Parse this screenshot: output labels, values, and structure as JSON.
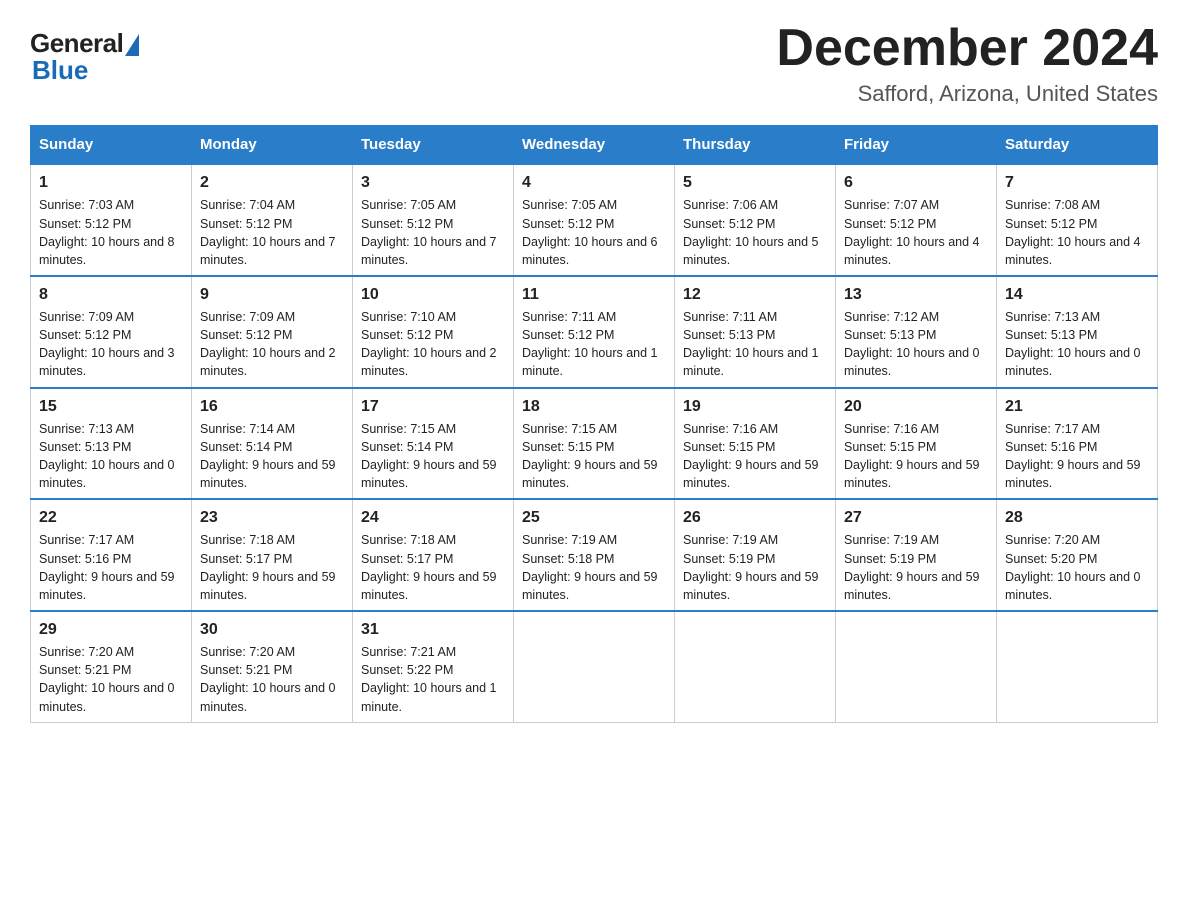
{
  "logo": {
    "general": "General",
    "blue": "Blue"
  },
  "title": "December 2024",
  "location": "Safford, Arizona, United States",
  "days": [
    "Sunday",
    "Monday",
    "Tuesday",
    "Wednesday",
    "Thursday",
    "Friday",
    "Saturday"
  ],
  "weeks": [
    [
      {
        "date": "1",
        "sunrise": "7:03 AM",
        "sunset": "5:12 PM",
        "daylight": "10 hours and 8 minutes."
      },
      {
        "date": "2",
        "sunrise": "7:04 AM",
        "sunset": "5:12 PM",
        "daylight": "10 hours and 7 minutes."
      },
      {
        "date": "3",
        "sunrise": "7:05 AM",
        "sunset": "5:12 PM",
        "daylight": "10 hours and 7 minutes."
      },
      {
        "date": "4",
        "sunrise": "7:05 AM",
        "sunset": "5:12 PM",
        "daylight": "10 hours and 6 minutes."
      },
      {
        "date": "5",
        "sunrise": "7:06 AM",
        "sunset": "5:12 PM",
        "daylight": "10 hours and 5 minutes."
      },
      {
        "date": "6",
        "sunrise": "7:07 AM",
        "sunset": "5:12 PM",
        "daylight": "10 hours and 4 minutes."
      },
      {
        "date": "7",
        "sunrise": "7:08 AM",
        "sunset": "5:12 PM",
        "daylight": "10 hours and 4 minutes."
      }
    ],
    [
      {
        "date": "8",
        "sunrise": "7:09 AM",
        "sunset": "5:12 PM",
        "daylight": "10 hours and 3 minutes."
      },
      {
        "date": "9",
        "sunrise": "7:09 AM",
        "sunset": "5:12 PM",
        "daylight": "10 hours and 2 minutes."
      },
      {
        "date": "10",
        "sunrise": "7:10 AM",
        "sunset": "5:12 PM",
        "daylight": "10 hours and 2 minutes."
      },
      {
        "date": "11",
        "sunrise": "7:11 AM",
        "sunset": "5:12 PM",
        "daylight": "10 hours and 1 minute."
      },
      {
        "date": "12",
        "sunrise": "7:11 AM",
        "sunset": "5:13 PM",
        "daylight": "10 hours and 1 minute."
      },
      {
        "date": "13",
        "sunrise": "7:12 AM",
        "sunset": "5:13 PM",
        "daylight": "10 hours and 0 minutes."
      },
      {
        "date": "14",
        "sunrise": "7:13 AM",
        "sunset": "5:13 PM",
        "daylight": "10 hours and 0 minutes."
      }
    ],
    [
      {
        "date": "15",
        "sunrise": "7:13 AM",
        "sunset": "5:13 PM",
        "daylight": "10 hours and 0 minutes."
      },
      {
        "date": "16",
        "sunrise": "7:14 AM",
        "sunset": "5:14 PM",
        "daylight": "9 hours and 59 minutes."
      },
      {
        "date": "17",
        "sunrise": "7:15 AM",
        "sunset": "5:14 PM",
        "daylight": "9 hours and 59 minutes."
      },
      {
        "date": "18",
        "sunrise": "7:15 AM",
        "sunset": "5:15 PM",
        "daylight": "9 hours and 59 minutes."
      },
      {
        "date": "19",
        "sunrise": "7:16 AM",
        "sunset": "5:15 PM",
        "daylight": "9 hours and 59 minutes."
      },
      {
        "date": "20",
        "sunrise": "7:16 AM",
        "sunset": "5:15 PM",
        "daylight": "9 hours and 59 minutes."
      },
      {
        "date": "21",
        "sunrise": "7:17 AM",
        "sunset": "5:16 PM",
        "daylight": "9 hours and 59 minutes."
      }
    ],
    [
      {
        "date": "22",
        "sunrise": "7:17 AM",
        "sunset": "5:16 PM",
        "daylight": "9 hours and 59 minutes."
      },
      {
        "date": "23",
        "sunrise": "7:18 AM",
        "sunset": "5:17 PM",
        "daylight": "9 hours and 59 minutes."
      },
      {
        "date": "24",
        "sunrise": "7:18 AM",
        "sunset": "5:17 PM",
        "daylight": "9 hours and 59 minutes."
      },
      {
        "date": "25",
        "sunrise": "7:19 AM",
        "sunset": "5:18 PM",
        "daylight": "9 hours and 59 minutes."
      },
      {
        "date": "26",
        "sunrise": "7:19 AM",
        "sunset": "5:19 PM",
        "daylight": "9 hours and 59 minutes."
      },
      {
        "date": "27",
        "sunrise": "7:19 AM",
        "sunset": "5:19 PM",
        "daylight": "9 hours and 59 minutes."
      },
      {
        "date": "28",
        "sunrise": "7:20 AM",
        "sunset": "5:20 PM",
        "daylight": "10 hours and 0 minutes."
      }
    ],
    [
      {
        "date": "29",
        "sunrise": "7:20 AM",
        "sunset": "5:21 PM",
        "daylight": "10 hours and 0 minutes."
      },
      {
        "date": "30",
        "sunrise": "7:20 AM",
        "sunset": "5:21 PM",
        "daylight": "10 hours and 0 minutes."
      },
      {
        "date": "31",
        "sunrise": "7:21 AM",
        "sunset": "5:22 PM",
        "daylight": "10 hours and 1 minute."
      },
      null,
      null,
      null,
      null
    ]
  ]
}
